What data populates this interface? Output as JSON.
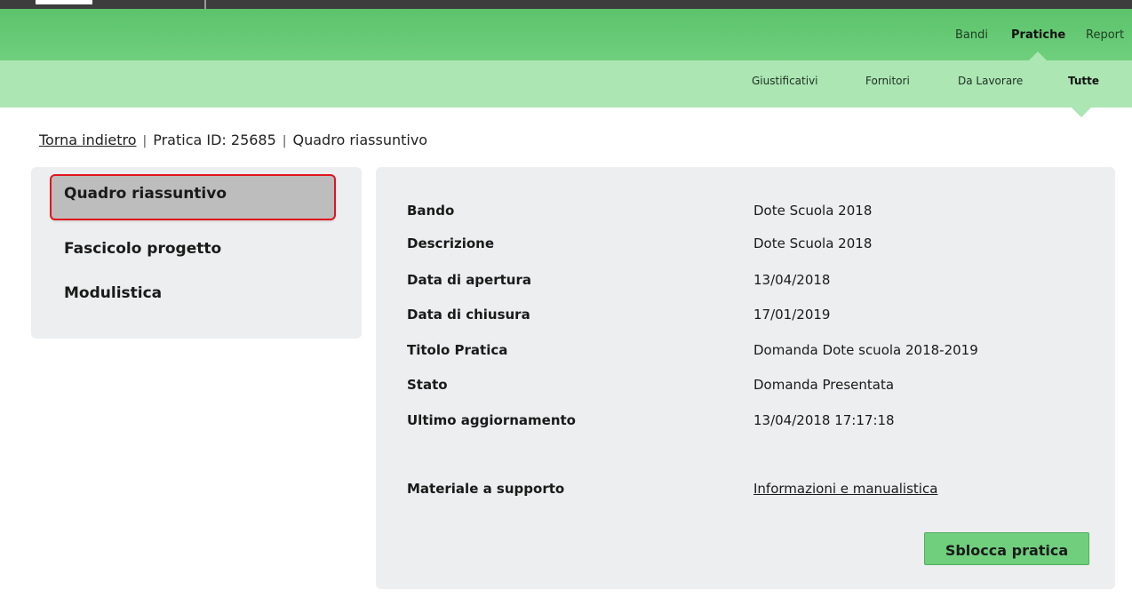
{
  "main_nav": {
    "items": [
      {
        "label": "Bandi",
        "active": false
      },
      {
        "label": "Pratiche",
        "active": true
      },
      {
        "label": "Report",
        "active": false
      }
    ]
  },
  "sub_nav": {
    "items": [
      {
        "label": "Giustificativi",
        "active": false
      },
      {
        "label": "Fornitori",
        "active": false
      },
      {
        "label": "Da Lavorare",
        "active": false
      },
      {
        "label": "Tutte",
        "active": true
      }
    ]
  },
  "breadcrumb": {
    "back_link": "Torna indietro",
    "separator": "|",
    "pratica_id": "Pratica ID: 25685",
    "current": "Quadro riassuntivo"
  },
  "sidebar": {
    "items": [
      {
        "label": "Quadro riassuntivo",
        "selected": true
      },
      {
        "label": "Fascicolo progetto",
        "selected": false
      },
      {
        "label": "Modulistica",
        "selected": false
      }
    ]
  },
  "details": {
    "rows": [
      {
        "label": "Bando",
        "value": "Dote Scuola 2018"
      },
      {
        "label": "Descrizione",
        "value": "Dote Scuola 2018"
      },
      {
        "label": "Data di apertura",
        "value": "13/04/2018"
      },
      {
        "label": "Data di chiusura",
        "value": "17/01/2019"
      },
      {
        "label": "Titolo Pratica",
        "value": "Domanda Dote scuola 2018-2019"
      },
      {
        "label": "Stato",
        "value": "Domanda Presentata"
      },
      {
        "label": "Ultimo aggiornamento",
        "value": "13/04/2018 17:17:18"
      }
    ],
    "support": {
      "label": "Materiale a supporto",
      "link": "Informazioni e manualistica"
    }
  },
  "actions": {
    "unlock_label": "Sblocca pratica"
  },
  "colors": {
    "nav_green": "#5cc36b",
    "subnav_green": "#abe6b3",
    "button_green": "#6fcf7d",
    "highlight_red": "#e0141c",
    "panel_gray": "#eceeef"
  }
}
